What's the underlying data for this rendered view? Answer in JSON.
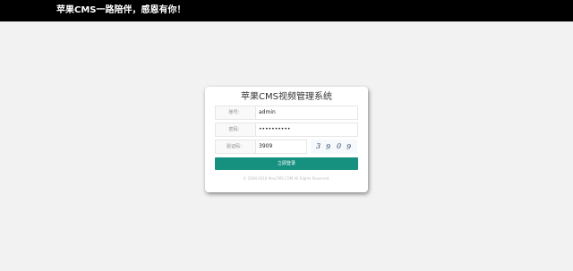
{
  "header": {
    "slogan": "苹果CMS一路陪伴，感恩有你！"
  },
  "login": {
    "title": "苹果CMS视频管理系统",
    "username_label": "账号：",
    "username_value": "admin",
    "password_label": "密码：",
    "password_value": "••••••••••",
    "captcha_label": "验证码：",
    "captcha_value": "3909",
    "captcha_image": {
      "d1": "3",
      "d2": "9",
      "d3": "0",
      "d4": "9"
    },
    "submit_label": "立即登录",
    "copyright": "© 2008-2018 MacCMS.COM All Rights Reserved."
  },
  "colors": {
    "topbar": "#000000",
    "button": "#16917f",
    "background": "#f2f2f2"
  }
}
